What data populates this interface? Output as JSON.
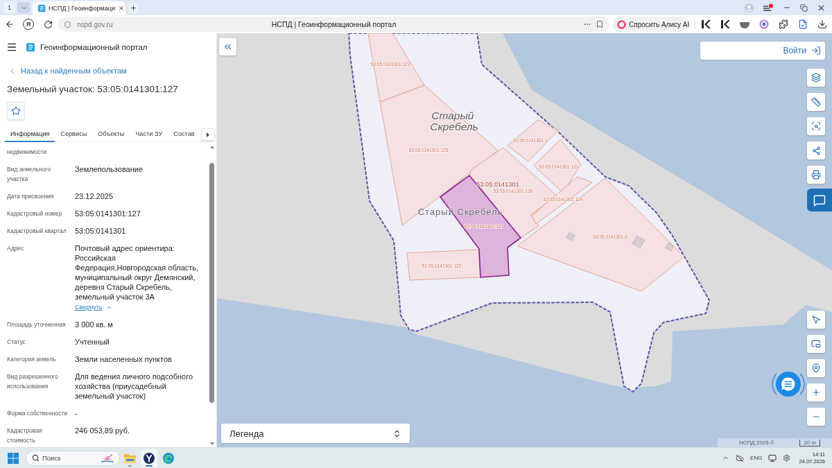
{
  "browser": {
    "tab_counter": "1",
    "tabs": [
      {
        "title": "НСПД | Геоинформаци",
        "selected": true
      }
    ],
    "home_button": "Я",
    "address": "nspd.gov.ru",
    "page_title": "НСПД | Геоинформационный портал",
    "assistant_button": "Спросить Алису AI"
  },
  "header": {
    "title": "Геоинформационный портал"
  },
  "object_card": {
    "back_link": "Назад к найденным объектам",
    "title": "Земельный участок: 53:05:0141301:127",
    "tabs": [
      {
        "label": "Информация",
        "selected": true
      },
      {
        "label": "Сервисы",
        "selected": false
      },
      {
        "label": "Объекты",
        "selected": false
      },
      {
        "label": "Части ЗУ",
        "selected": false
      },
      {
        "label": "Состав",
        "selected": false
      }
    ],
    "fields": [
      {
        "label": "недвижимости"
      },
      {
        "label": "Вид земельного участка",
        "value": "Землепользование"
      },
      {
        "label": "Дата присвоения",
        "value": "23.12.2025"
      },
      {
        "label": "Кадастровый номер",
        "value": "53:05:0141301:127"
      },
      {
        "label": "Кадастровый квартал",
        "value": "53:05:0141301"
      },
      {
        "label": "Адрес",
        "value": "Почтовый адрес ориентира: Российская Федерация,Новгородская область, муниципальный округ Демянский, деревня Старый Скребель, земельный участок 3А",
        "toggle": "Свернуть",
        "expanded": true
      },
      {
        "label": "Площадь уточненная",
        "value": "3 000 кв. м"
      },
      {
        "label": "Статус",
        "value": "Учтенный"
      },
      {
        "label": "Категория земель",
        "value": "Земли населенных пунктов"
      },
      {
        "label": "Вид разрешенного использования",
        "value": "Для ведения личного подсобного хозяйства (приусадебный земельный участок)"
      },
      {
        "label": "Форма собственности",
        "value": "-"
      },
      {
        "label": "Кадастровая стоимость",
        "value": "246 053,89 руб."
      }
    ]
  },
  "map": {
    "parcels": [
      {
        "label": "53:05:0141301:123",
        "selected": false
      },
      {
        "label": "53:05:0141301:1",
        "selected": false
      },
      {
        "label": "53:05:0141301:125",
        "selected": false
      },
      {
        "label": "53:05:0141301:121",
        "selected": false
      },
      {
        "label": "53:05:0141301:126",
        "selected": false
      },
      {
        "label": "53:05:0141301:124",
        "selected": false
      },
      {
        "label": "53:05:0141301:127",
        "selected": true
      },
      {
        "label": "53:05:0141301:3",
        "selected": false
      },
      {
        "label": "53:05:0141301:122",
        "selected": false
      }
    ],
    "quarter_label": "53:05:0141301",
    "place_labels": [
      {
        "text": "Старый Скребель",
        "kind": "settlement"
      },
      {
        "text": "Старый Скребель",
        "kind": "territory"
      }
    ],
    "login_button": "Войти",
    "legend_button": "Легенда",
    "attribution": "НСПД 2026 ©",
    "scale": "20 m"
  },
  "taskbar": {
    "search": {
      "placeholder": "Поиск"
    },
    "apps": [
      {
        "kind": "files",
        "running": true,
        "active": false
      },
      {
        "kind": "browser",
        "running": true,
        "active": true
      },
      {
        "kind": "edge",
        "running": false,
        "active": false
      }
    ],
    "language": "ENG",
    "time": "14:11",
    "date": "24.07.2026"
  }
}
